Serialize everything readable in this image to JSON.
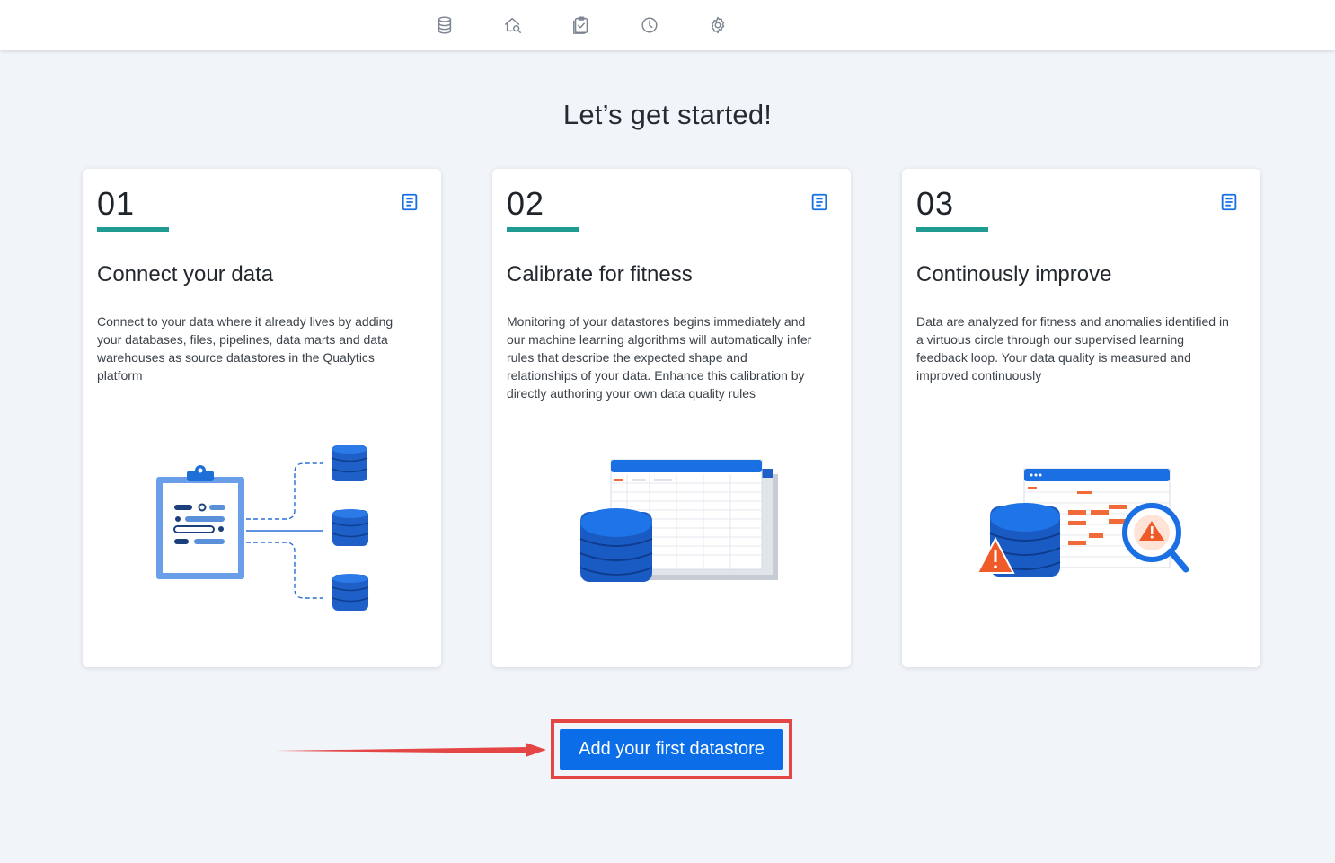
{
  "nav": {
    "icons": [
      "database-icon",
      "explore-search-icon",
      "checklist-clipboard-icon",
      "clock-icon",
      "settings-gear-icon"
    ]
  },
  "page": {
    "title": "Let’s get started!"
  },
  "steps": [
    {
      "number": "01",
      "title": "Connect your data",
      "description": "Connect to your data where it already lives by adding your databases, files, pipelines, data marts and data warehouses as source datastores in the Qualytics platform"
    },
    {
      "number": "02",
      "title": "Calibrate for fitness",
      "description": "Monitoring of your datastores begins immediately and our machine learning algorithms will automatically infer rules that describe the expected shape and relationships of your data. Enhance this calibration by directly authoring your own data quality rules"
    },
    {
      "number": "03",
      "title": "Continously improve",
      "description": "Data are analyzed for fitness and anomalies identified in a virtuous circle through our supervised learning feedback loop. Your data quality is measured and improved continuously"
    }
  ],
  "cta": {
    "label": "Add your first datastore"
  },
  "colors": {
    "accent_teal": "#1f9b92",
    "primary_blue": "#0b6ee8",
    "highlight_red": "#e44545",
    "background": "#f1f5f9"
  }
}
